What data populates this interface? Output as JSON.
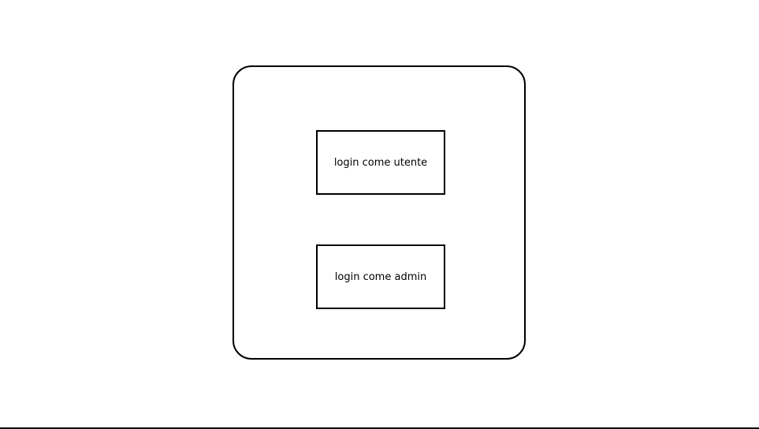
{
  "buttons": {
    "user_label": "login come utente",
    "admin_label": "login come admin"
  }
}
